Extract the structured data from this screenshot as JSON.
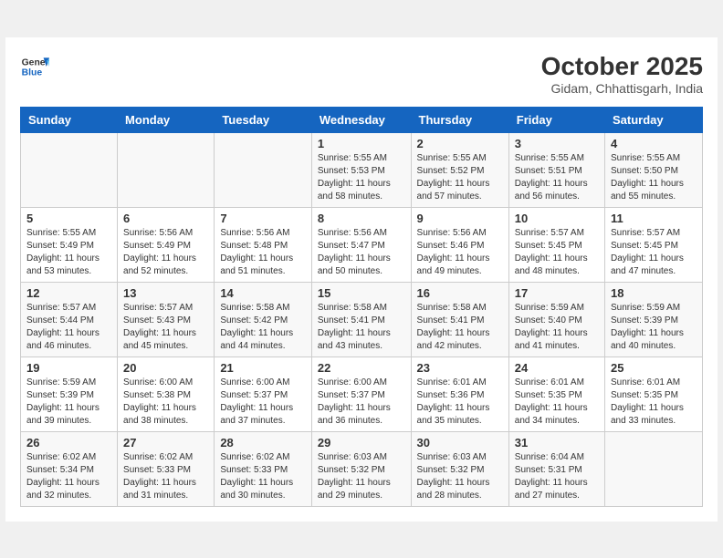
{
  "header": {
    "logo_line1": "General",
    "logo_line2": "Blue",
    "title": "October 2025",
    "subtitle": "Gidam, Chhattisgarh, India"
  },
  "weekdays": [
    "Sunday",
    "Monday",
    "Tuesday",
    "Wednesday",
    "Thursday",
    "Friday",
    "Saturday"
  ],
  "weeks": [
    [
      {
        "day": "",
        "info": ""
      },
      {
        "day": "",
        "info": ""
      },
      {
        "day": "",
        "info": ""
      },
      {
        "day": "1",
        "info": "Sunrise: 5:55 AM\nSunset: 5:53 PM\nDaylight: 11 hours\nand 58 minutes."
      },
      {
        "day": "2",
        "info": "Sunrise: 5:55 AM\nSunset: 5:52 PM\nDaylight: 11 hours\nand 57 minutes."
      },
      {
        "day": "3",
        "info": "Sunrise: 5:55 AM\nSunset: 5:51 PM\nDaylight: 11 hours\nand 56 minutes."
      },
      {
        "day": "4",
        "info": "Sunrise: 5:55 AM\nSunset: 5:50 PM\nDaylight: 11 hours\nand 55 minutes."
      }
    ],
    [
      {
        "day": "5",
        "info": "Sunrise: 5:55 AM\nSunset: 5:49 PM\nDaylight: 11 hours\nand 53 minutes."
      },
      {
        "day": "6",
        "info": "Sunrise: 5:56 AM\nSunset: 5:49 PM\nDaylight: 11 hours\nand 52 minutes."
      },
      {
        "day": "7",
        "info": "Sunrise: 5:56 AM\nSunset: 5:48 PM\nDaylight: 11 hours\nand 51 minutes."
      },
      {
        "day": "8",
        "info": "Sunrise: 5:56 AM\nSunset: 5:47 PM\nDaylight: 11 hours\nand 50 minutes."
      },
      {
        "day": "9",
        "info": "Sunrise: 5:56 AM\nSunset: 5:46 PM\nDaylight: 11 hours\nand 49 minutes."
      },
      {
        "day": "10",
        "info": "Sunrise: 5:57 AM\nSunset: 5:45 PM\nDaylight: 11 hours\nand 48 minutes."
      },
      {
        "day": "11",
        "info": "Sunrise: 5:57 AM\nSunset: 5:45 PM\nDaylight: 11 hours\nand 47 minutes."
      }
    ],
    [
      {
        "day": "12",
        "info": "Sunrise: 5:57 AM\nSunset: 5:44 PM\nDaylight: 11 hours\nand 46 minutes."
      },
      {
        "day": "13",
        "info": "Sunrise: 5:57 AM\nSunset: 5:43 PM\nDaylight: 11 hours\nand 45 minutes."
      },
      {
        "day": "14",
        "info": "Sunrise: 5:58 AM\nSunset: 5:42 PM\nDaylight: 11 hours\nand 44 minutes."
      },
      {
        "day": "15",
        "info": "Sunrise: 5:58 AM\nSunset: 5:41 PM\nDaylight: 11 hours\nand 43 minutes."
      },
      {
        "day": "16",
        "info": "Sunrise: 5:58 AM\nSunset: 5:41 PM\nDaylight: 11 hours\nand 42 minutes."
      },
      {
        "day": "17",
        "info": "Sunrise: 5:59 AM\nSunset: 5:40 PM\nDaylight: 11 hours\nand 41 minutes."
      },
      {
        "day": "18",
        "info": "Sunrise: 5:59 AM\nSunset: 5:39 PM\nDaylight: 11 hours\nand 40 minutes."
      }
    ],
    [
      {
        "day": "19",
        "info": "Sunrise: 5:59 AM\nSunset: 5:39 PM\nDaylight: 11 hours\nand 39 minutes."
      },
      {
        "day": "20",
        "info": "Sunrise: 6:00 AM\nSunset: 5:38 PM\nDaylight: 11 hours\nand 38 minutes."
      },
      {
        "day": "21",
        "info": "Sunrise: 6:00 AM\nSunset: 5:37 PM\nDaylight: 11 hours\nand 37 minutes."
      },
      {
        "day": "22",
        "info": "Sunrise: 6:00 AM\nSunset: 5:37 PM\nDaylight: 11 hours\nand 36 minutes."
      },
      {
        "day": "23",
        "info": "Sunrise: 6:01 AM\nSunset: 5:36 PM\nDaylight: 11 hours\nand 35 minutes."
      },
      {
        "day": "24",
        "info": "Sunrise: 6:01 AM\nSunset: 5:35 PM\nDaylight: 11 hours\nand 34 minutes."
      },
      {
        "day": "25",
        "info": "Sunrise: 6:01 AM\nSunset: 5:35 PM\nDaylight: 11 hours\nand 33 minutes."
      }
    ],
    [
      {
        "day": "26",
        "info": "Sunrise: 6:02 AM\nSunset: 5:34 PM\nDaylight: 11 hours\nand 32 minutes."
      },
      {
        "day": "27",
        "info": "Sunrise: 6:02 AM\nSunset: 5:33 PM\nDaylight: 11 hours\nand 31 minutes."
      },
      {
        "day": "28",
        "info": "Sunrise: 6:02 AM\nSunset: 5:33 PM\nDaylight: 11 hours\nand 30 minutes."
      },
      {
        "day": "29",
        "info": "Sunrise: 6:03 AM\nSunset: 5:32 PM\nDaylight: 11 hours\nand 29 minutes."
      },
      {
        "day": "30",
        "info": "Sunrise: 6:03 AM\nSunset: 5:32 PM\nDaylight: 11 hours\nand 28 minutes."
      },
      {
        "day": "31",
        "info": "Sunrise: 6:04 AM\nSunset: 5:31 PM\nDaylight: 11 hours\nand 27 minutes."
      },
      {
        "day": "",
        "info": ""
      }
    ]
  ]
}
